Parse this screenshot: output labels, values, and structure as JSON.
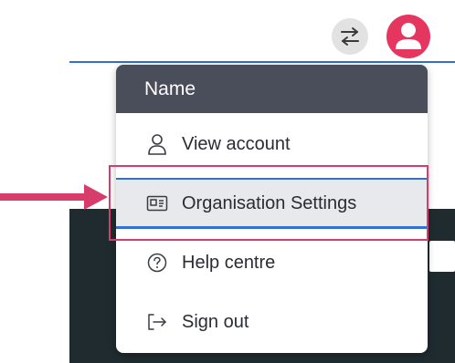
{
  "header": {
    "switch_icon": "swap-arrows-icon",
    "avatar_icon": "user-avatar-icon"
  },
  "menu": {
    "title": "Name",
    "items": [
      {
        "label": "View account",
        "icon": "person-icon"
      },
      {
        "label": "Organisation Settings",
        "icon": "id-card-icon",
        "highlighted": true
      },
      {
        "label": "Help centre",
        "icon": "question-circle-icon"
      },
      {
        "label": "Sign out",
        "icon": "sign-out-icon"
      }
    ]
  },
  "annotation": {
    "arrow_icon": "pointer-arrow-icon"
  },
  "colors": {
    "accent": "#e5365f",
    "header_bg": "#4a4d5a",
    "highlight": "#d83c6b",
    "focus": "#2f6fd6"
  }
}
